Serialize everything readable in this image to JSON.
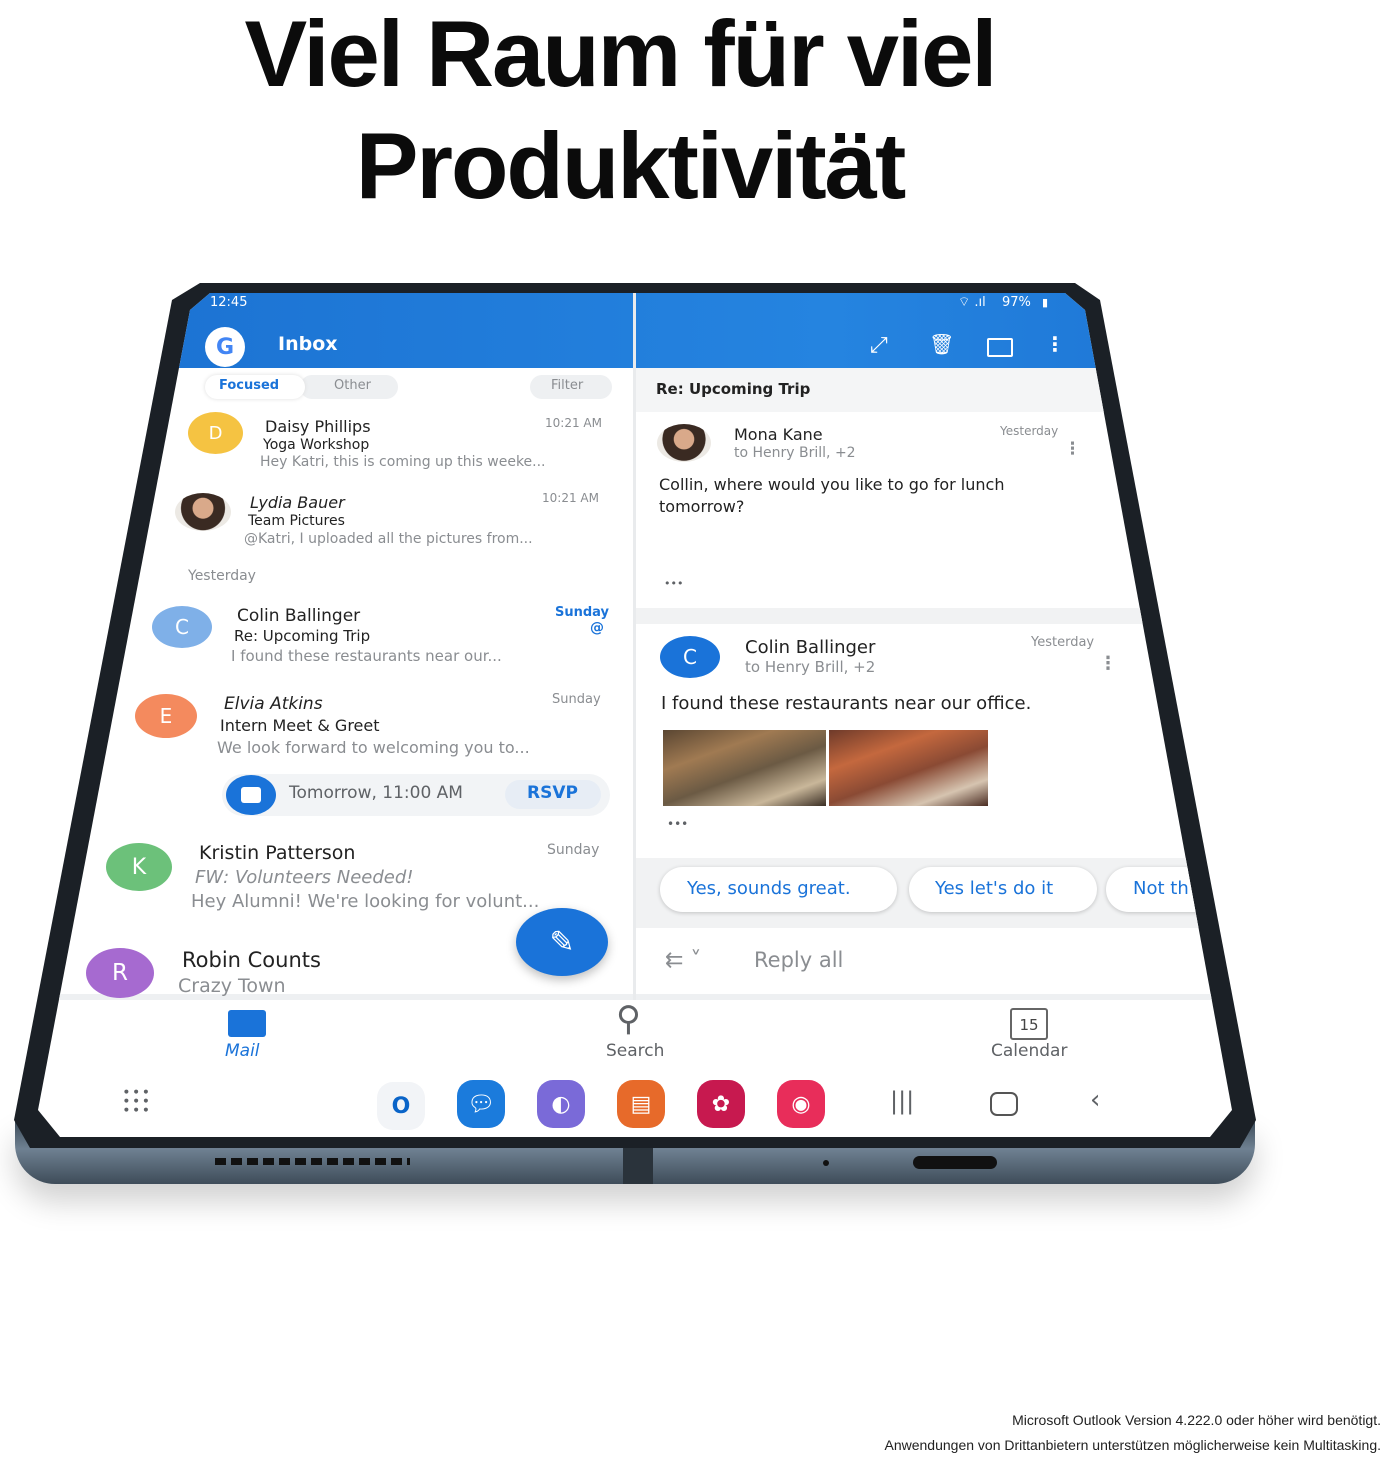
{
  "headline": {
    "line1": "Viel Raum für viel",
    "line2": "Produktivität"
  },
  "status_bar": {
    "time": "12:45",
    "battery": "97%"
  },
  "app_bar": {
    "title": "Inbox",
    "icons": [
      "expand-icon",
      "trash-icon",
      "archive-icon",
      "more-vertical-icon"
    ]
  },
  "tabs": {
    "focused": "Focused",
    "other": "Other",
    "filter": "Filter"
  },
  "colors": {
    "accent": "#1a73d9",
    "yellow": "#f5c342",
    "light_blue": "#7fb0e8",
    "orange": "#f48a5e",
    "green": "#6cc17a",
    "purple": "#a66ad0"
  },
  "messages": [
    {
      "initial": "D",
      "sender": "Daisy Phillips",
      "subject": "Yoga Workshop",
      "preview": "Hey Katri, this is coming up this weeke...",
      "time": "10:21 AM"
    },
    {
      "initial": "",
      "sender": "Lydia Bauer",
      "subject": "Team Pictures",
      "preview": "@Katri, I uploaded all the pictures from...",
      "time": "10:21 AM"
    },
    {
      "initial": "C",
      "sender": "Colin Ballinger",
      "subject": "Re: Upcoming Trip",
      "preview": "I found these restaurants near our...",
      "time": "Sunday",
      "mention": "@"
    },
    {
      "initial": "E",
      "sender": "Elvia Atkins",
      "subject": "Intern Meet & Greet",
      "preview": "We look forward to welcoming you to...",
      "time": "Sunday"
    },
    {
      "initial": "K",
      "sender": "Kristin Patterson",
      "subject": "FW: Volunteers Needed!",
      "preview": "Hey Alumni! We're looking for volunt...",
      "time": "Sunday"
    },
    {
      "initial": "R",
      "sender": "Robin Counts",
      "subject": "Crazy Town"
    }
  ],
  "section_yesterday": "Yesterday",
  "event": {
    "time": "Tomorrow, 11:00 AM",
    "rsvp": "RSVP"
  },
  "thread": {
    "subject": "Re: Upcoming Trip",
    "items": [
      {
        "sender": "Mona Kane",
        "to": "to Henry Brill, +2",
        "time": "Yesterday",
        "body": "Collin, where would  you like to go for lunch tomorrow?",
        "more": "•••"
      },
      {
        "initial": "C",
        "sender": "Colin Ballinger",
        "to": "to Henry Brill, +2",
        "time": "Yesterday",
        "body": "I found these restaurants near our office.",
        "more": "•••"
      }
    ],
    "quick_replies": [
      "Yes, sounds great.",
      "Yes let's do it",
      "Not th"
    ],
    "reply_all": "Reply all"
  },
  "bottom_nav": [
    {
      "label": "Mail",
      "icon": "mail-icon",
      "active": true
    },
    {
      "label": "Search",
      "icon": "search-icon"
    },
    {
      "label": "Calendar",
      "icon": "calendar-icon",
      "day": "15"
    }
  ],
  "dock": [
    "outlook-icon",
    "messages-icon",
    "internet-icon",
    "notes-icon",
    "gallery-icon",
    "screen-recorder-icon"
  ],
  "footnotes": [
    "Microsoft Outlook Version 4.222.0 oder höher wird benötigt.",
    "Anwendungen von Drittanbietern unterstützen möglicherweise kein Multitasking."
  ]
}
